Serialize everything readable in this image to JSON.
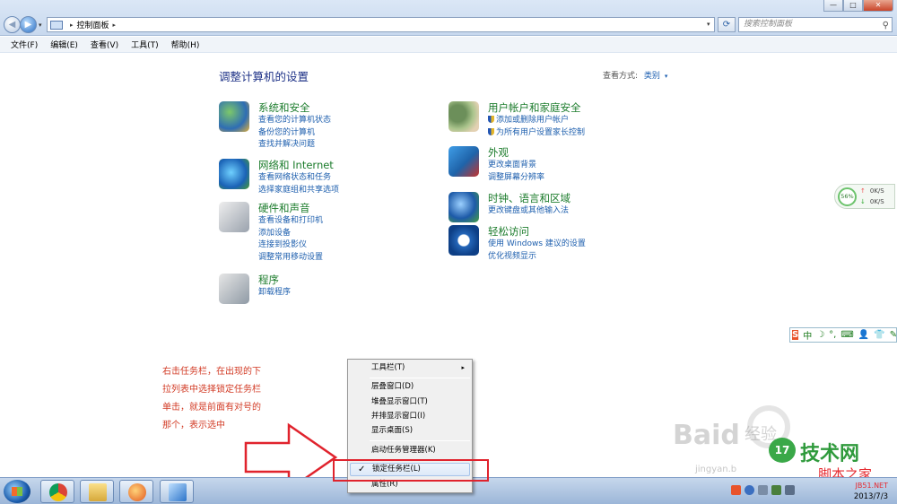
{
  "window": {
    "min_label": "—",
    "max_label": "□",
    "close_label": "✕"
  },
  "nav": {
    "back_glyph": "◀",
    "forward_glyph": "▶",
    "dropdown_glyph": "▾"
  },
  "address": {
    "separator": "▸",
    "location": "控制面板",
    "separator2": "▸",
    "dropdown_glyph": "▾",
    "refresh_glyph": "⟳"
  },
  "search": {
    "placeholder": "搜索控制面板",
    "icon_glyph": "⚲"
  },
  "menubar": {
    "items": [
      "文件(F)",
      "编辑(E)",
      "查看(V)",
      "工具(T)",
      "帮助(H)"
    ]
  },
  "main": {
    "title": "调整计算机的设置",
    "view_by_label": "查看方式:",
    "view_by_value": "类别",
    "view_by_arrow": "▾",
    "categories": [
      {
        "icon": "security-shield-icon",
        "title": "系统和安全",
        "links": [
          "查看您的计算机状态",
          "备份您的计算机",
          "查找并解决问题"
        ]
      },
      {
        "icon": "network-globe-icon",
        "title": "网络和 Internet",
        "links": [
          "查看网络状态和任务",
          "选择家庭组和共享选项"
        ]
      },
      {
        "icon": "printer-icon",
        "title": "硬件和声音",
        "links": [
          "查看设备和打印机",
          "添加设备",
          "连接到投影仪",
          "调整常用移动设置"
        ]
      },
      {
        "icon": "programs-box-icon",
        "title": "程序",
        "links": [
          "卸载程序"
        ]
      },
      {
        "icon": "users-icon",
        "title": "用户帐户和家庭安全",
        "links": [
          "添加或删除用户帐户",
          "为所有用户设置家长控制"
        ]
      },
      {
        "icon": "appearance-monitor-icon",
        "title": "外观",
        "links": [
          "更改桌面背景",
          "调整屏幕分辨率"
        ]
      },
      {
        "icon": "clock-globe-icon",
        "title": "时钟、语言和区域",
        "links": [
          "更改键盘或其他输入法"
        ]
      },
      {
        "icon": "ease-of-access-icon",
        "title": "轻松访问",
        "links": [
          "使用 Windows 建议的设置",
          "优化视频显示"
        ]
      }
    ]
  },
  "net_widget": {
    "percent": "56%",
    "up_arrow": "↑",
    "down_arrow": "↓",
    "up": "0K/S",
    "down": "0K/S"
  },
  "ime_bar": {
    "items": [
      "S",
      "中",
      "☽",
      "°,",
      "⌨",
      "👤",
      "👕",
      "✎"
    ]
  },
  "annotation": {
    "text": "右击任务栏，在出现的下拉列表中选择锁定任务栏单击，就是前面有对号的那个，表示选中"
  },
  "context_menu": {
    "toolbars": "工具栏(T)",
    "submenu_arrow": "▸",
    "cascade": "层叠窗口(D)",
    "stack": "堆叠显示窗口(T)",
    "side_by_side": "并排显示窗口(I)",
    "show_desktop": "显示桌面(S)",
    "task_manager": "启动任务管理器(K)",
    "check_mark": "✓",
    "lock_taskbar": "锁定任务栏(L)",
    "properties": "属性(R)"
  },
  "watermarks": {
    "baidu": "Baid",
    "jingyan": "经验",
    "url": "jingyan.b",
    "seventeen": "17",
    "tech": "技术网",
    "jb51": "脚本之家",
    "jb51_net": "JB51.NET"
  },
  "taskbar": {
    "date": "2013/7/3"
  },
  "colors": {
    "link_blue": "#1e5fae",
    "category_green": "#1c7c2c",
    "annotation_red": "#d23a24",
    "highlight_box_red": "#e0232d"
  }
}
